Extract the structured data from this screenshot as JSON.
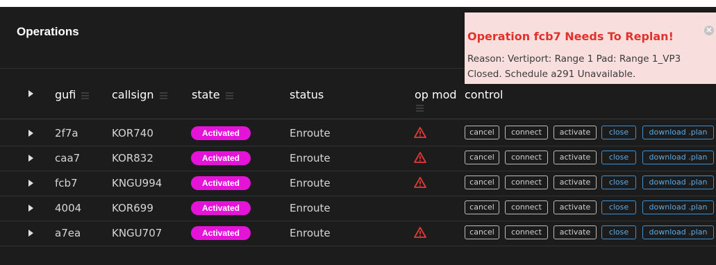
{
  "panel": {
    "title": "Operations"
  },
  "headers": {
    "gufi": "gufi",
    "callsign": "callsign",
    "state": "state",
    "status": "status",
    "op_mod": "op mod",
    "control": "control"
  },
  "rows": [
    {
      "gufi": "2f7a",
      "callsign": "KOR740",
      "state": "Activated",
      "status": "Enroute",
      "warning": true
    },
    {
      "gufi": "caa7",
      "callsign": "KOR832",
      "state": "Activated",
      "status": "Enroute",
      "warning": true
    },
    {
      "gufi": "fcb7",
      "callsign": "KNGU994",
      "state": "Activated",
      "status": "Enroute",
      "warning": true
    },
    {
      "gufi": "4004",
      "callsign": "KOR699",
      "state": "Activated",
      "status": "Enroute",
      "warning": false
    },
    {
      "gufi": "a7ea",
      "callsign": "KNGU707",
      "state": "Activated",
      "status": "Enroute",
      "warning": true
    }
  ],
  "controls": {
    "cancel": "cancel",
    "connect": "connect",
    "activate": "activate",
    "close": "close",
    "download": "download .plan"
  },
  "toast": {
    "title": "Operation fcb7 Needs To Replan!",
    "message": "Reason: Vertiport: Range 1 Pad: Range 1_VP3 Closed. Schedule a291 Unavailable.",
    "close_icon": "✕"
  },
  "colors": {
    "badge": "#e512d7",
    "warning": "#e53935",
    "toast_title": "#e0322b",
    "link_blue": "#3d93d6"
  },
  "icons": [
    "expand-arrow-icon",
    "sort-icon",
    "warning-icon",
    "close-icon"
  ]
}
